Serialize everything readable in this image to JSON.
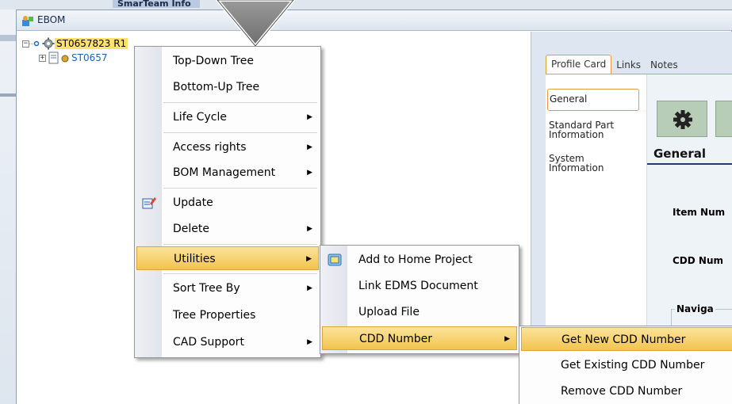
{
  "background_tab": "SmarTeam Info",
  "window": {
    "title": "EBOM"
  },
  "tree": {
    "root": {
      "expander": "−",
      "label": "ST0657823 R1"
    },
    "child": {
      "expander": "+",
      "label": "ST0657"
    }
  },
  "panel": {
    "tabs": [
      {
        "label": "Profile Card"
      },
      {
        "label": "Links"
      },
      {
        "label": "Notes"
      }
    ],
    "side_nav": [
      {
        "label": "General"
      },
      {
        "label": "Standard Part Information"
      },
      {
        "label": "System Information"
      }
    ],
    "heading": "General",
    "fields": [
      {
        "label": "Item Num"
      },
      {
        "label": "CDD Num"
      }
    ],
    "group_title": "Naviga"
  },
  "context_menu": {
    "items": [
      {
        "label": "Top-Down Tree"
      },
      {
        "label": "Bottom-Up Tree"
      },
      {
        "label": "Life Cycle"
      },
      {
        "label": "Access rights"
      },
      {
        "label": "BOM Management"
      },
      {
        "label": "Update"
      },
      {
        "label": "Delete"
      },
      {
        "label": "Utilities"
      },
      {
        "label": "Sort Tree By"
      },
      {
        "label": "Tree Properties"
      },
      {
        "label": "CAD Support"
      }
    ]
  },
  "utilities_menu": {
    "items": [
      {
        "label": "Add to Home Project"
      },
      {
        "label": "Link EDMS Document"
      },
      {
        "label": "Upload File"
      },
      {
        "label": "CDD Number"
      }
    ]
  },
  "cdd_menu": {
    "items": [
      {
        "label": "Get New CDD Number"
      },
      {
        "label": "Get Existing CDD Number"
      },
      {
        "label": "Remove CDD Number"
      }
    ]
  },
  "colors": {
    "highlight": "#f5cd5a",
    "selection": "#ffe26a",
    "accent_tab": "#e59c3a"
  }
}
